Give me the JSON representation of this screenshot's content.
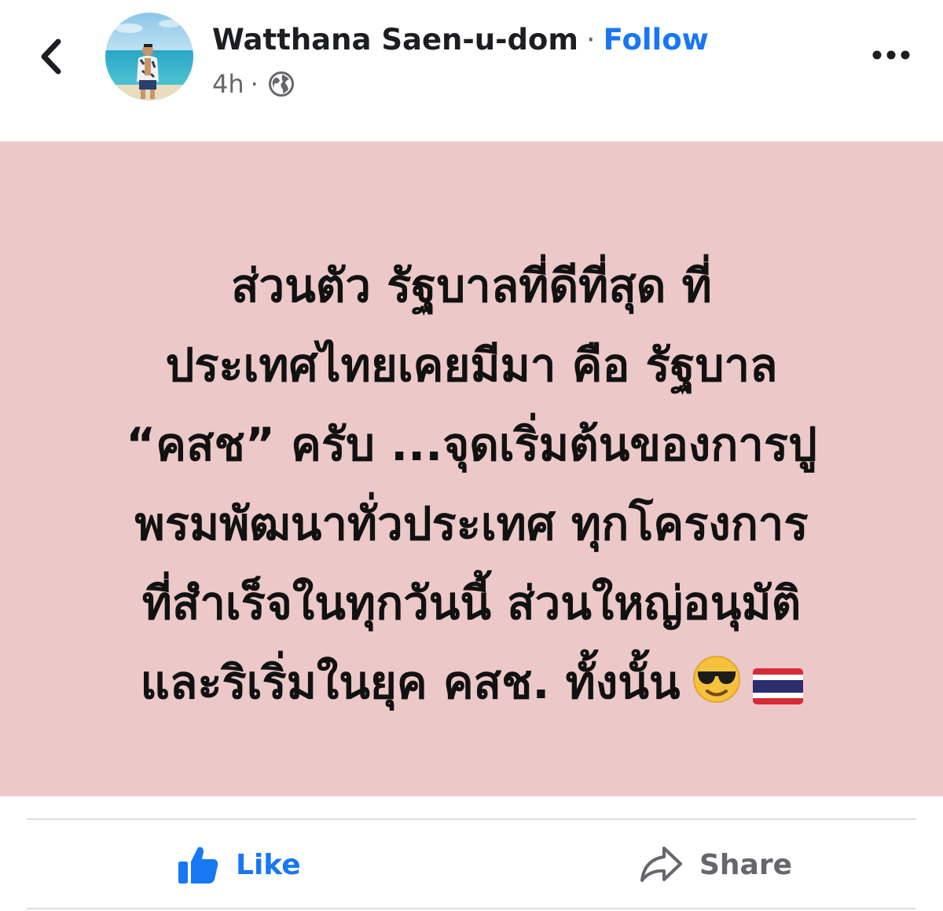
{
  "post": {
    "author": {
      "name": "Watthana Saen-u-dom",
      "separator": "·",
      "follow_label": "Follow"
    },
    "meta": {
      "time": "4h",
      "separator": "·",
      "audience_icon": "globe-icon"
    },
    "more_icon": "more-options-icon",
    "back_icon": "chevron-left-icon",
    "background_color": "#ecc8c9",
    "text_lines": [
      "ส่วนตัว รัฐบาลที่ดีที่สุด ที่",
      "ประเทศไทยเคยมีมา คือ รัฐบาล",
      "“คสช” ครับ ...จุดเริ่มต้นของการปู",
      "พรมพัฒนาทั่วประเทศ ทุกโครงการ",
      "ที่สำเร็จในทุกวันนี้ ส่วนใหญ่อนุมัติ",
      "และริเริ่มในยุค คสช. ทั้งนั้น"
    ],
    "emojis": [
      "smiling-face-with-sunglasses",
      "thailand-flag"
    ]
  },
  "actions": {
    "like_label": "Like",
    "share_label": "Share",
    "like_color": "#1877f2",
    "share_color": "#65676b"
  }
}
